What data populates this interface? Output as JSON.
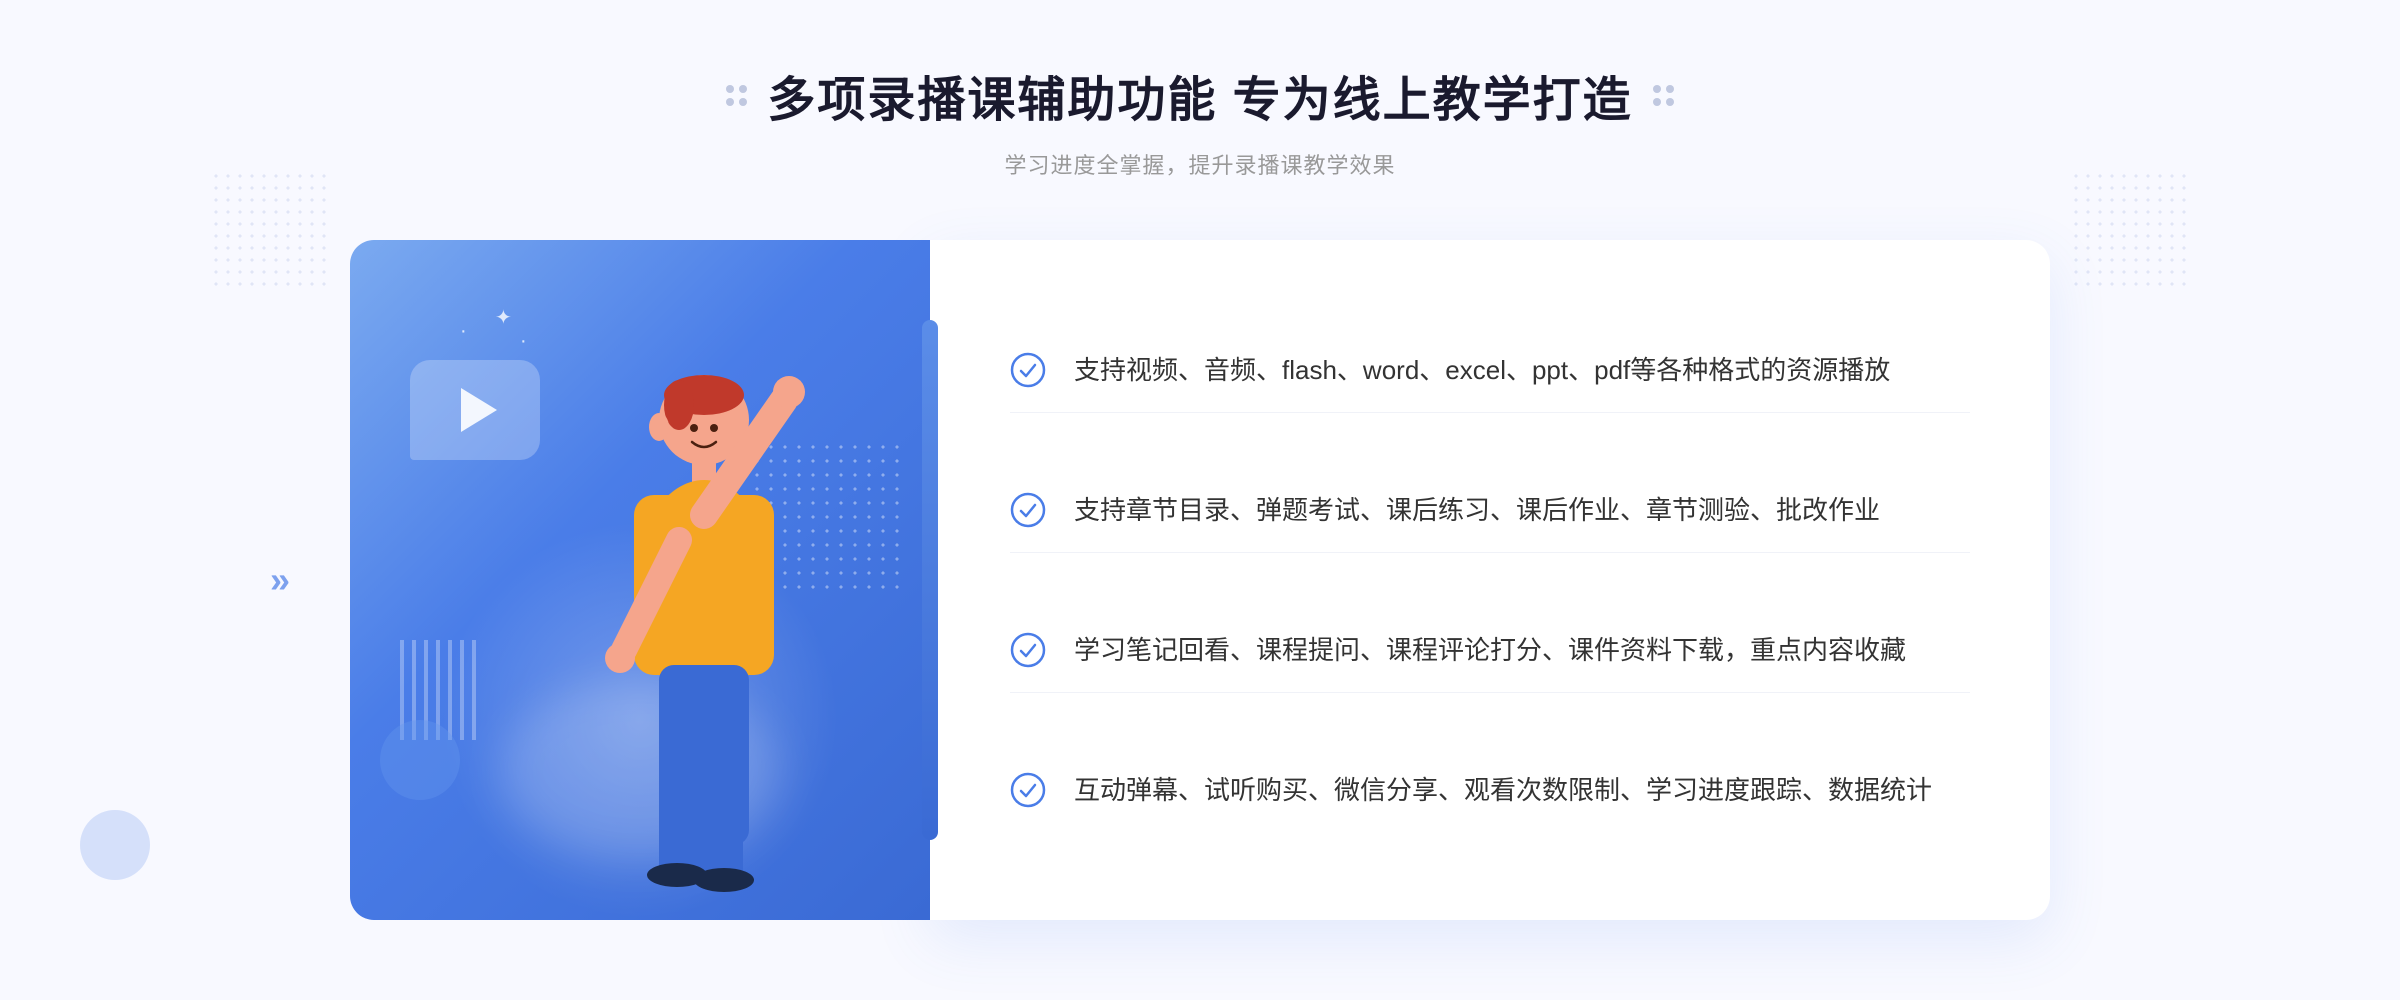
{
  "header": {
    "title": "多项录播课辅助功能 专为线上教学打造",
    "subtitle": "学习进度全掌握，提升录播课教学效果",
    "dots_decoration": "◈"
  },
  "features": [
    {
      "id": "feature-1",
      "text": "支持视频、音频、flash、word、excel、ppt、pdf等各种格式的资源播放"
    },
    {
      "id": "feature-2",
      "text": "支持章节目录、弹题考试、课后练习、课后作业、章节测验、批改作业"
    },
    {
      "id": "feature-3",
      "text": "学习笔记回看、课程提问、课程评论打分、课件资料下载，重点内容收藏"
    },
    {
      "id": "feature-4",
      "text": "互动弹幕、试听购买、微信分享、观看次数限制、学习进度跟踪、数据统计"
    }
  ],
  "illustration": {
    "play_button_label": "▶",
    "arrow_label": "»"
  },
  "colors": {
    "primary_blue": "#4a7de8",
    "light_blue": "#7baaf0",
    "check_color": "#4a7de8",
    "text_dark": "#333333",
    "text_gray": "#999999"
  }
}
